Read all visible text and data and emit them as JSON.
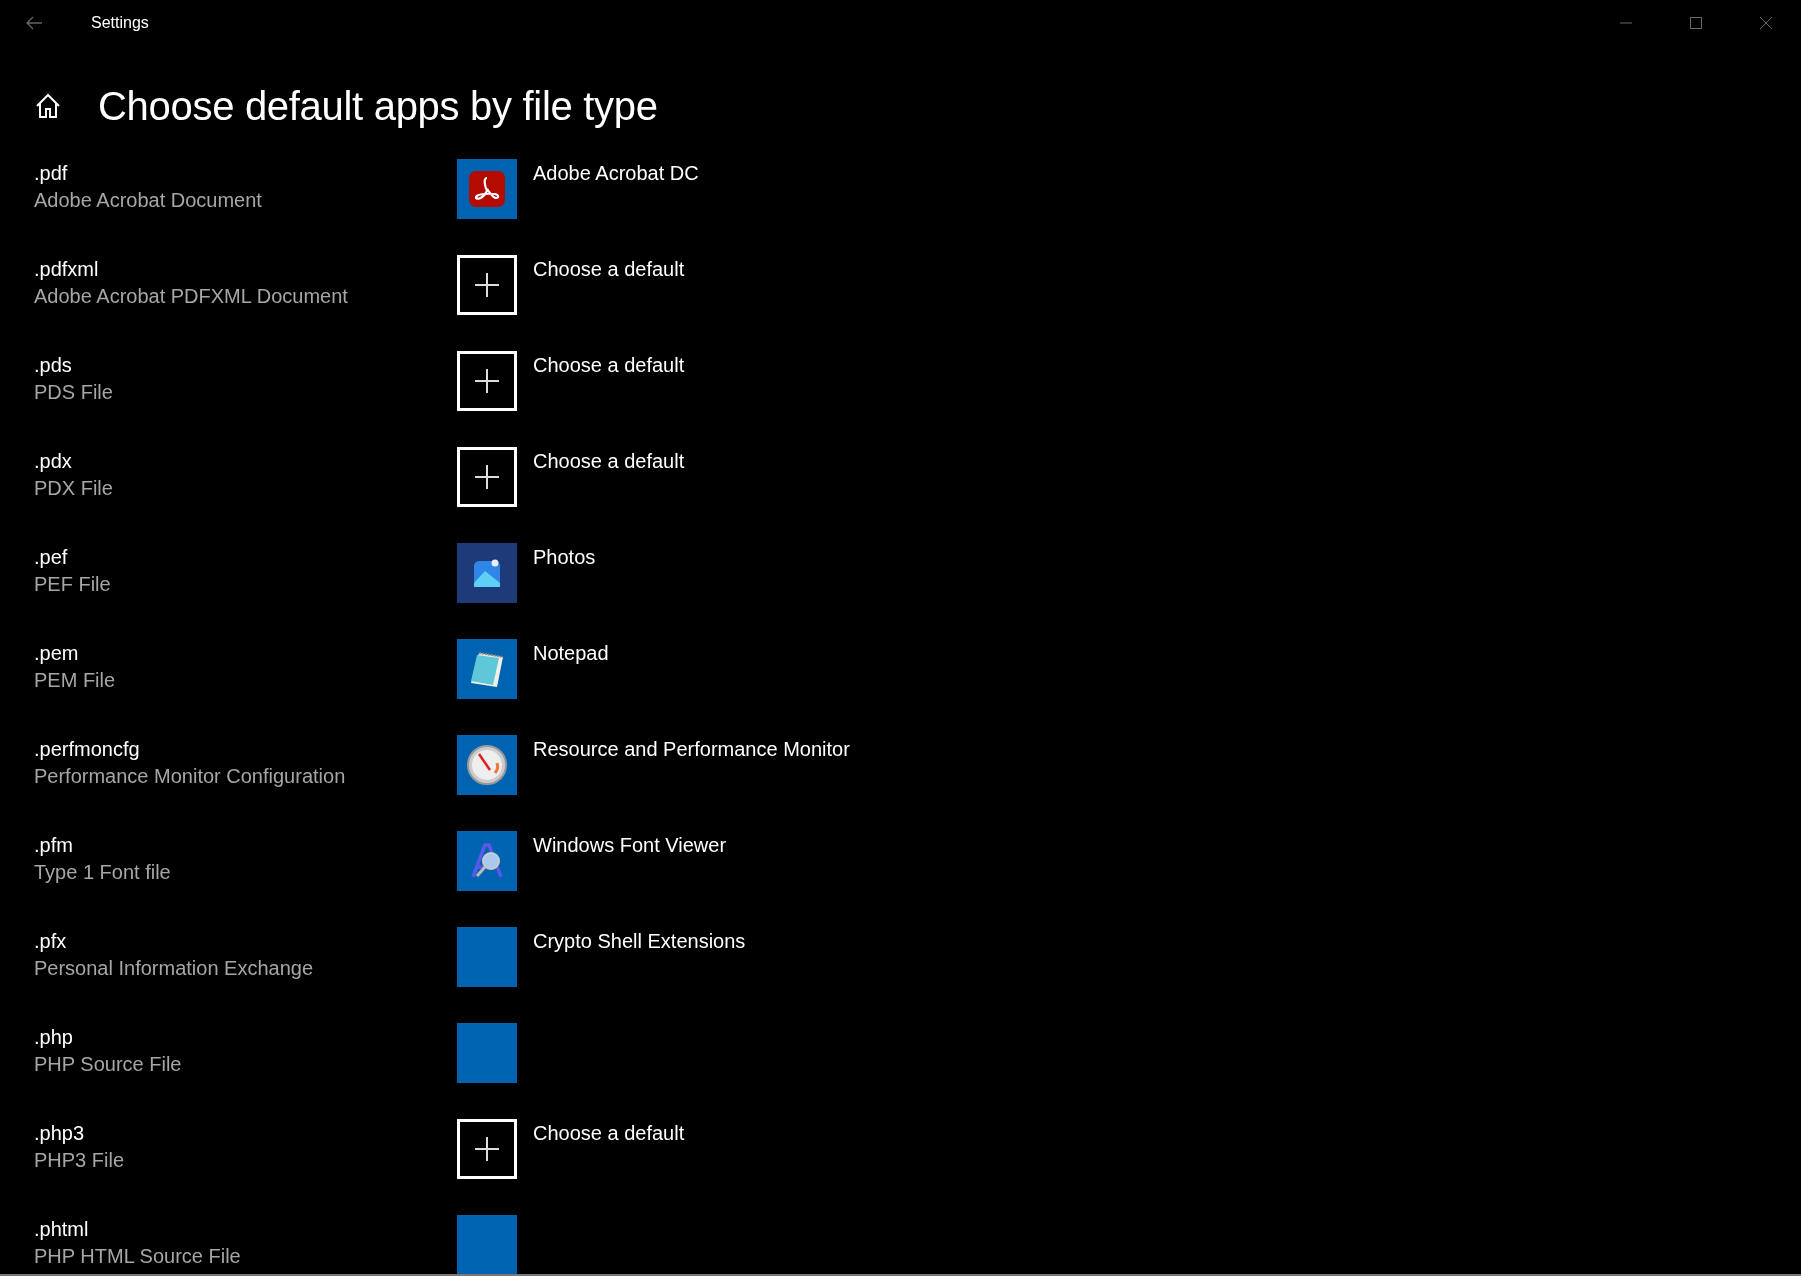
{
  "window": {
    "title": "Settings"
  },
  "page": {
    "heading": "Choose default apps by file type"
  },
  "file_types": [
    {
      "extension": ".pdf",
      "description": "Adobe Acrobat Document",
      "app": {
        "kind": "acrobat",
        "name": "Adobe Acrobat DC"
      }
    },
    {
      "extension": ".pdfxml",
      "description": "Adobe Acrobat PDFXML Document",
      "app": {
        "kind": "choose",
        "name": "Choose a default"
      }
    },
    {
      "extension": ".pds",
      "description": "PDS File",
      "app": {
        "kind": "choose",
        "name": "Choose a default"
      }
    },
    {
      "extension": ".pdx",
      "description": "PDX File",
      "app": {
        "kind": "choose",
        "name": "Choose a default"
      }
    },
    {
      "extension": ".pef",
      "description": "PEF File",
      "app": {
        "kind": "photos",
        "name": "Photos"
      }
    },
    {
      "extension": ".pem",
      "description": "PEM File",
      "app": {
        "kind": "notepad",
        "name": "Notepad"
      }
    },
    {
      "extension": ".perfmoncfg",
      "description": "Performance Monitor Configuration",
      "app": {
        "kind": "gauge",
        "name": "Resource and Performance Monitor"
      }
    },
    {
      "extension": ".pfm",
      "description": "Type 1 Font file",
      "app": {
        "kind": "font",
        "name": "Windows Font Viewer"
      }
    },
    {
      "extension": ".pfx",
      "description": "Personal Information Exchange",
      "app": {
        "kind": "blank",
        "name": "Crypto Shell Extensions"
      }
    },
    {
      "extension": ".php",
      "description": "PHP Source File",
      "app": {
        "kind": "blank"
      }
    },
    {
      "extension": ".php3",
      "description": "PHP3 File",
      "app": {
        "kind": "choose",
        "name": "Choose a default"
      }
    },
    {
      "extension": ".phtml",
      "description": "PHP HTML Source File",
      "app": {
        "kind": "blank"
      }
    }
  ]
}
